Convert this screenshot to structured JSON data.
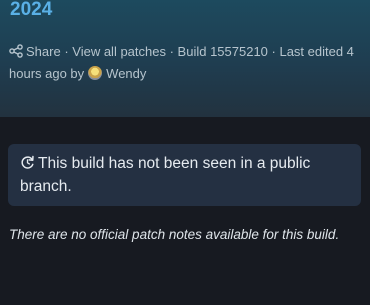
{
  "header": {
    "title": "2024"
  },
  "meta": {
    "share_label": "Share",
    "sep1": " · ",
    "view_patches_label": "View all patches",
    "sep2": " · ",
    "build_text": "Build 15575210",
    "sep3": " · ",
    "last_edited_text": "Last edited 4 hours ago by",
    "author_name": "Wendy",
    "icons": {
      "share": "share-icon",
      "avatar": "avatar"
    }
  },
  "notice": {
    "icon": "refresh-icon",
    "text": "This build has not been seen in a public branch."
  },
  "patch_notes": {
    "text": "There are no official patch notes available for this build."
  },
  "colors": {
    "accent": "#5ab0e6",
    "background": "#171a21",
    "notice_bg": "#243042"
  }
}
